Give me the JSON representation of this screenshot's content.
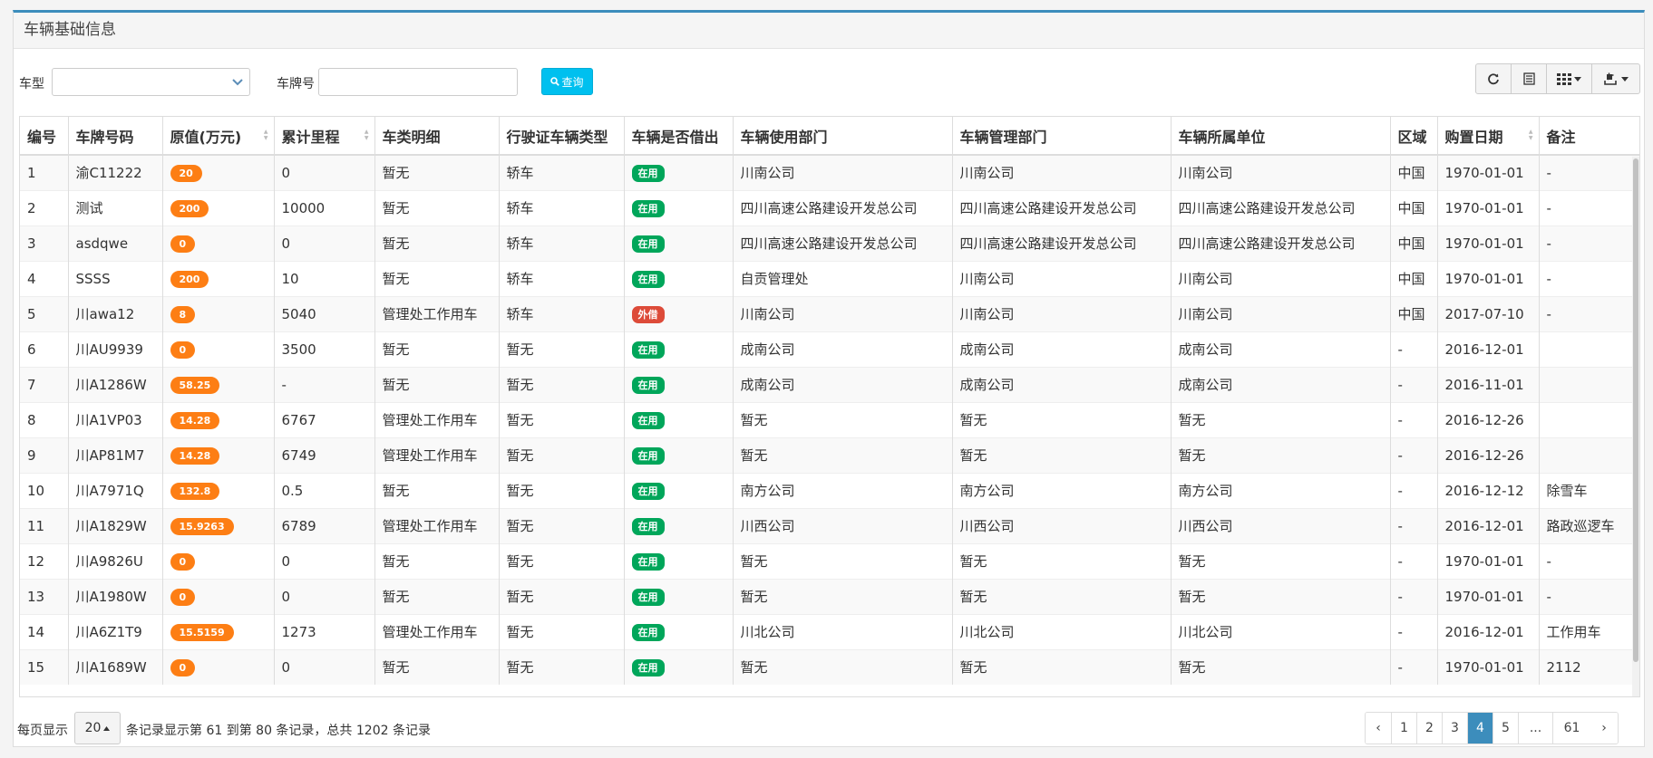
{
  "panel": {
    "title": "车辆基础信息"
  },
  "filters": {
    "car_type_label": "车型",
    "car_type_value": "",
    "plate_label": "车牌号",
    "plate_value": "",
    "search_label": "查询"
  },
  "toolbar": {
    "refresh_icon": "refresh-icon",
    "toggle_icon": "list-view-icon",
    "columns_icon": "columns-grid-icon",
    "export_icon": "export-icon"
  },
  "columns": [
    "编号",
    "车牌号码",
    "原值(万元)",
    "累计里程",
    "车类明细",
    "行驶证车辆类型",
    "车辆是否借出",
    "车辆使用部门",
    "车辆管理部门",
    "车辆所属单位",
    "区域",
    "购置日期",
    "备注"
  ],
  "rows": [
    {
      "no": "1",
      "plate": "渝C11222",
      "value": "20",
      "mileage": "0",
      "detail": "暂无",
      "lic_type": "轿车",
      "loan": "在用",
      "use_dept": "川南公司",
      "mgmt_dept": "川南公司",
      "owner": "川南公司",
      "region": "中国",
      "date": "1970-01-01",
      "remark": "-"
    },
    {
      "no": "2",
      "plate": "测试",
      "value": "200",
      "mileage": "10000",
      "detail": "暂无",
      "lic_type": "轿车",
      "loan": "在用",
      "use_dept": "四川高速公路建设开发总公司",
      "mgmt_dept": "四川高速公路建设开发总公司",
      "owner": "四川高速公路建设开发总公司",
      "region": "中国",
      "date": "1970-01-01",
      "remark": "-"
    },
    {
      "no": "3",
      "plate": "asdqwe",
      "value": "0",
      "mileage": "0",
      "detail": "暂无",
      "lic_type": "轿车",
      "loan": "在用",
      "use_dept": "四川高速公路建设开发总公司",
      "mgmt_dept": "四川高速公路建设开发总公司",
      "owner": "四川高速公路建设开发总公司",
      "region": "中国",
      "date": "1970-01-01",
      "remark": "-"
    },
    {
      "no": "4",
      "plate": "SSSS",
      "value": "200",
      "mileage": "10",
      "detail": "暂无",
      "lic_type": "轿车",
      "loan": "在用",
      "use_dept": "自贡管理处",
      "mgmt_dept": "川南公司",
      "owner": "川南公司",
      "region": "中国",
      "date": "1970-01-01",
      "remark": "-"
    },
    {
      "no": "5",
      "plate": "川awa12",
      "value": "8",
      "mileage": "5040",
      "detail": "管理处工作用车",
      "lic_type": "轿车",
      "loan": "外借",
      "use_dept": "川南公司",
      "mgmt_dept": "川南公司",
      "owner": "川南公司",
      "region": "中国",
      "date": "2017-07-10",
      "remark": "-"
    },
    {
      "no": "6",
      "plate": "川AU9939",
      "value": "0",
      "mileage": "3500",
      "detail": "暂无",
      "lic_type": "暂无",
      "loan": "在用",
      "use_dept": "成南公司",
      "mgmt_dept": "成南公司",
      "owner": "成南公司",
      "region": "-",
      "date": "2016-12-01",
      "remark": ""
    },
    {
      "no": "7",
      "plate": "川A1286W",
      "value": "58.25",
      "mileage": "-",
      "detail": "暂无",
      "lic_type": "暂无",
      "loan": "在用",
      "use_dept": "成南公司",
      "mgmt_dept": "成南公司",
      "owner": "成南公司",
      "region": "-",
      "date": "2016-11-01",
      "remark": ""
    },
    {
      "no": "8",
      "plate": "川A1VP03",
      "value": "14.28",
      "mileage": "6767",
      "detail": "管理处工作用车",
      "lic_type": "暂无",
      "loan": "在用",
      "use_dept": "暂无",
      "mgmt_dept": "暂无",
      "owner": "暂无",
      "region": "-",
      "date": "2016-12-26",
      "remark": ""
    },
    {
      "no": "9",
      "plate": "川AP81M7",
      "value": "14.28",
      "mileage": "6749",
      "detail": "管理处工作用车",
      "lic_type": "暂无",
      "loan": "在用",
      "use_dept": "暂无",
      "mgmt_dept": "暂无",
      "owner": "暂无",
      "region": "-",
      "date": "2016-12-26",
      "remark": ""
    },
    {
      "no": "10",
      "plate": "川A7971Q",
      "value": "132.8",
      "mileage": "0.5",
      "detail": "暂无",
      "lic_type": "暂无",
      "loan": "在用",
      "use_dept": "南方公司",
      "mgmt_dept": "南方公司",
      "owner": "南方公司",
      "region": "-",
      "date": "2016-12-12",
      "remark": "除雪车"
    },
    {
      "no": "11",
      "plate": "川A1829W",
      "value": "15.9263",
      "mileage": "6789",
      "detail": "管理处工作用车",
      "lic_type": "暂无",
      "loan": "在用",
      "use_dept": "川西公司",
      "mgmt_dept": "川西公司",
      "owner": "川西公司",
      "region": "-",
      "date": "2016-12-01",
      "remark": "路政巡逻车"
    },
    {
      "no": "12",
      "plate": "川A9826U",
      "value": "0",
      "mileage": "0",
      "detail": "暂无",
      "lic_type": "暂无",
      "loan": "在用",
      "use_dept": "暂无",
      "mgmt_dept": "暂无",
      "owner": "暂无",
      "region": "-",
      "date": "1970-01-01",
      "remark": "-"
    },
    {
      "no": "13",
      "plate": "川A1980W",
      "value": "0",
      "mileage": "0",
      "detail": "暂无",
      "lic_type": "暂无",
      "loan": "在用",
      "use_dept": "暂无",
      "mgmt_dept": "暂无",
      "owner": "暂无",
      "region": "-",
      "date": "1970-01-01",
      "remark": "-"
    },
    {
      "no": "14",
      "plate": "川A6Z1T9",
      "value": "15.5159",
      "mileage": "1273",
      "detail": "管理处工作用车",
      "lic_type": "暂无",
      "loan": "在用",
      "use_dept": "川北公司",
      "mgmt_dept": "川北公司",
      "owner": "川北公司",
      "region": "-",
      "date": "2016-12-01",
      "remark": "工作用车"
    },
    {
      "no": "15",
      "plate": "川A1689W",
      "value": "0",
      "mileage": "0",
      "detail": "暂无",
      "lic_type": "暂无",
      "loan": "在用",
      "use_dept": "暂无",
      "mgmt_dept": "暂无",
      "owner": "暂无",
      "region": "-",
      "date": "1970-01-01",
      "remark": "2112"
    }
  ],
  "footer": {
    "per_page_prefix": "每页显示",
    "page_size": "20",
    "summary": "条记录显示第 61 到第 80 条记录，总共 1202 条记录"
  },
  "pagination": {
    "prev": "‹",
    "pages": [
      "1",
      "2",
      "3",
      "4",
      "5",
      "...",
      "61"
    ],
    "active": "4",
    "next": "›"
  },
  "colors": {
    "accent": "#3c8dbc",
    "search_button": "#00c0ef",
    "value_badge": "#fd7e14",
    "in_use": "#00a65a",
    "loaned": "#dd4b39"
  }
}
